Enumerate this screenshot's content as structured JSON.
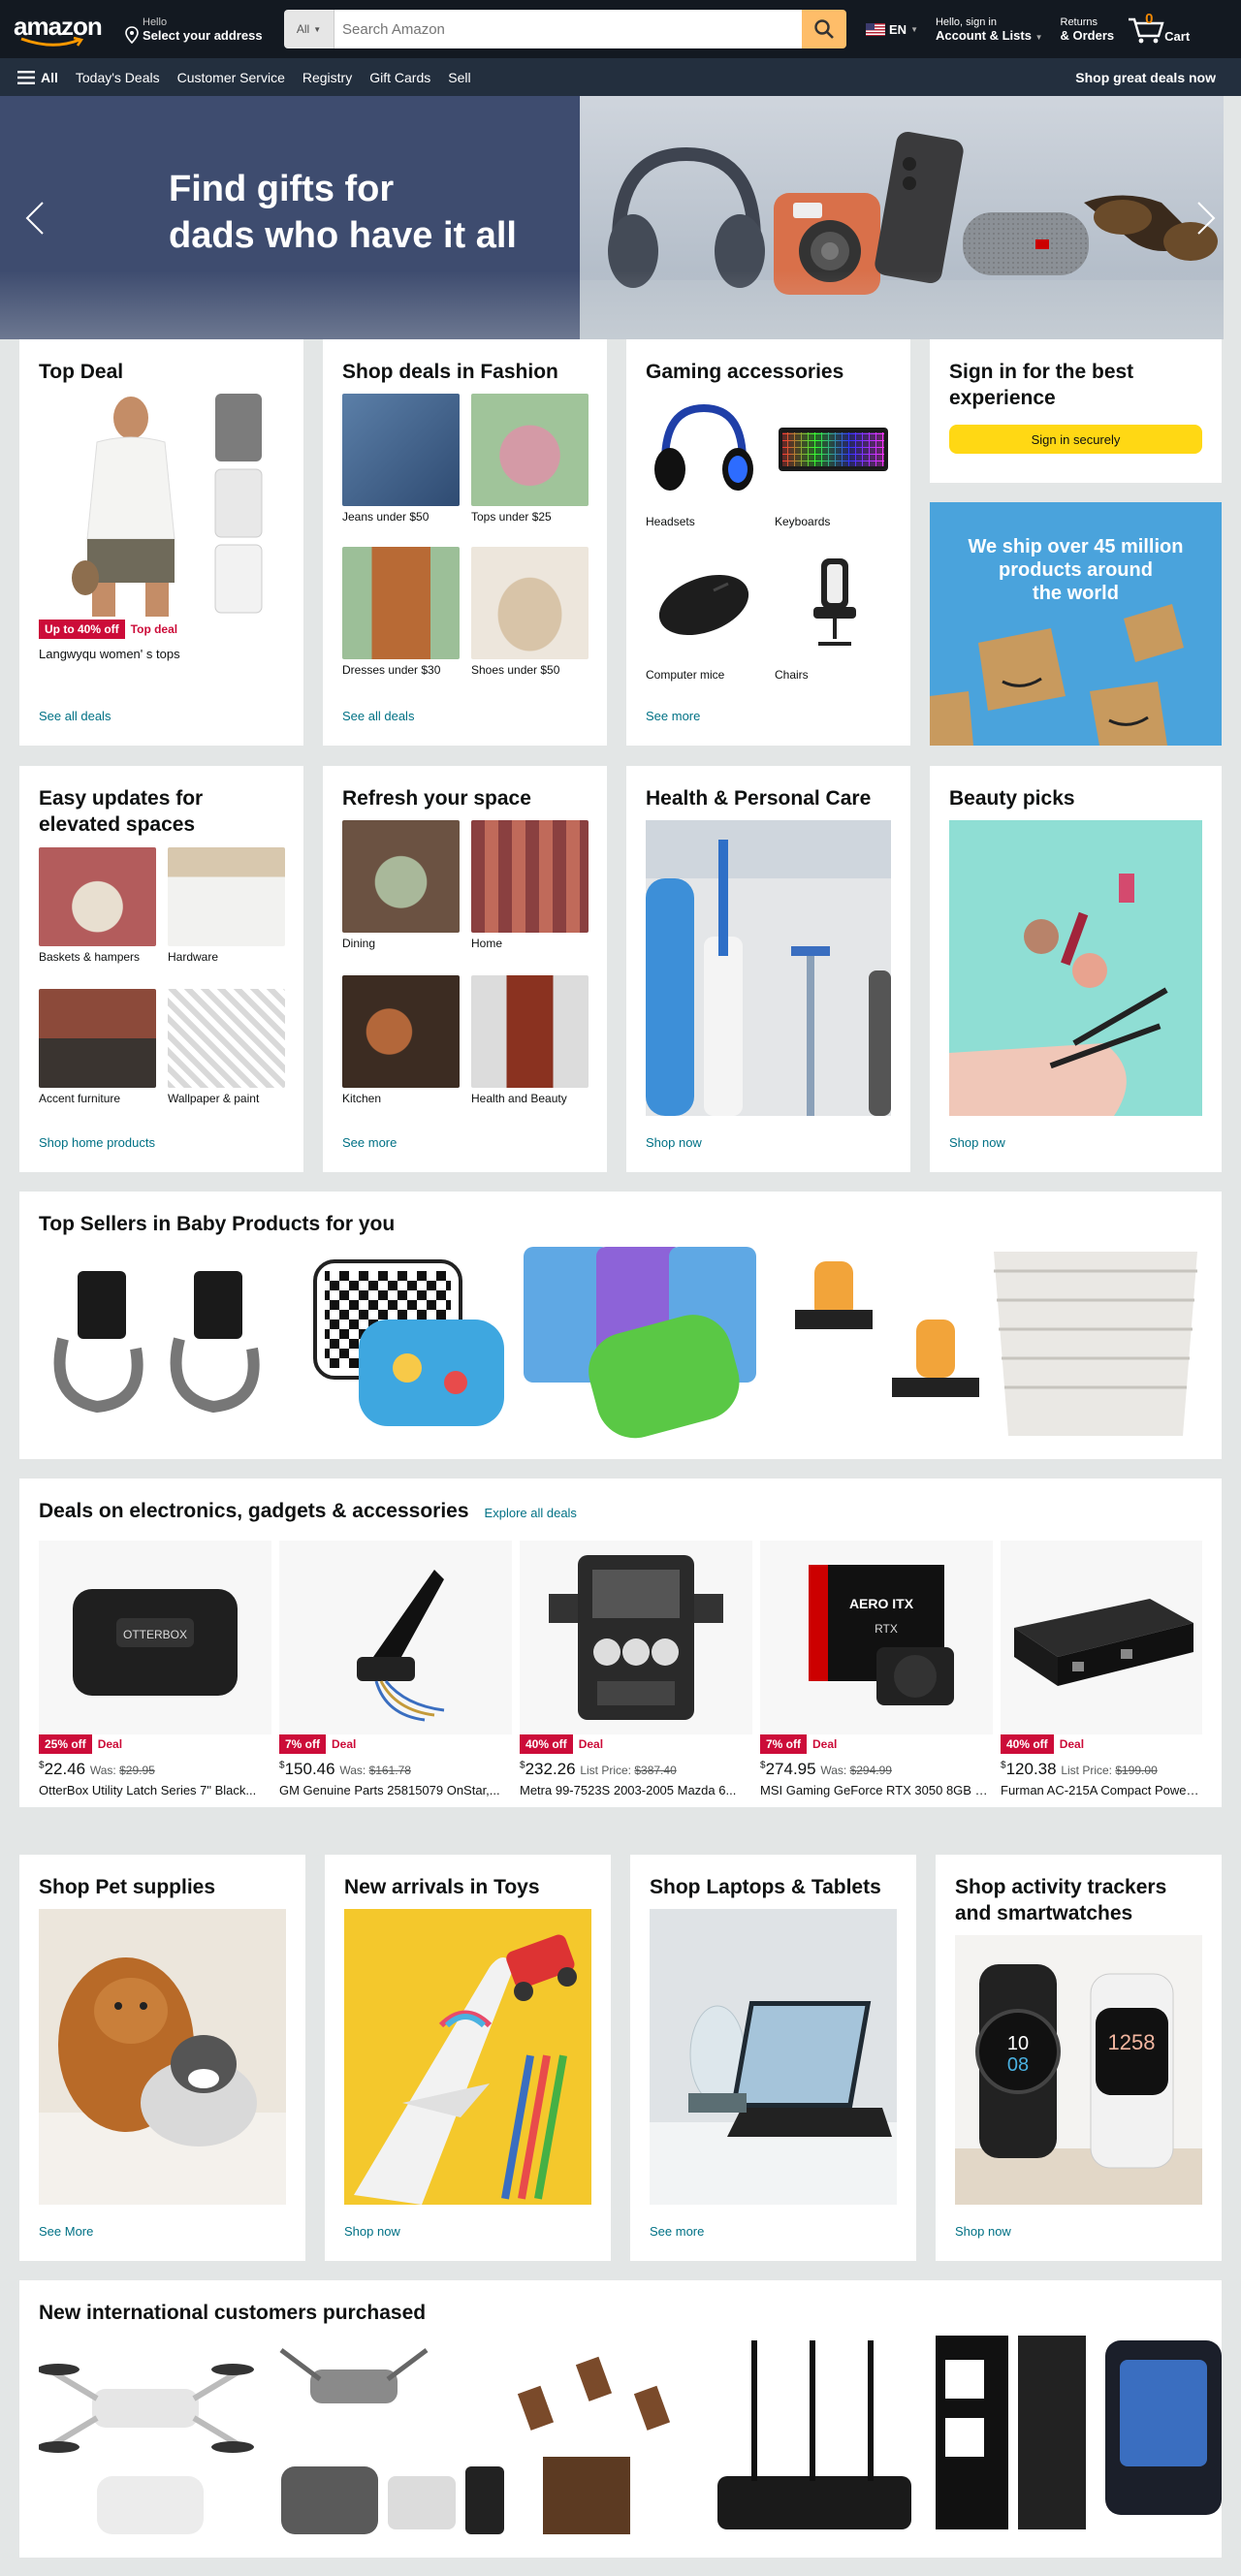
{
  "header": {
    "logo_text": "amazon",
    "address_line1": "Hello",
    "address_line2": "Select your address",
    "search_category": "All",
    "search_placeholder": "Search Amazon",
    "language": "EN",
    "account_line1": "Hello, sign in",
    "account_line2": "Account & Lists",
    "returns_line1": "Returns",
    "returns_line2": "& Orders",
    "cart_count": "0",
    "cart_label": "Cart"
  },
  "subnav": {
    "all_label": "All",
    "items": [
      "Today's Deals",
      "Customer Service",
      "Registry",
      "Gift Cards",
      "Sell"
    ],
    "right_label": "Shop great deals now"
  },
  "hero": {
    "title_line1": "Find gifts for",
    "title_line2": "dads who have it all"
  },
  "row1": {
    "top_deal": {
      "title": "Top Deal",
      "badge": "Up to 40% off",
      "deal_label": "Top deal",
      "product": "Langwyqu women' s tops",
      "link": "See all deals"
    },
    "fashion": {
      "title": "Shop deals in Fashion",
      "items": [
        "Jeans under $50",
        "Tops under $25",
        "Dresses under $30",
        "Shoes under $50"
      ],
      "link": "See all deals"
    },
    "gaming": {
      "title": "Gaming accessories",
      "items": [
        "Headsets",
        "Keyboards",
        "Computer mice",
        "Chairs"
      ],
      "link": "See more"
    },
    "signin": {
      "title": "Sign in for the best experience",
      "button": "Sign in securely"
    },
    "ship_banner": {
      "text_line1": "We ship over 45 million",
      "text_line2": "products around",
      "text_line3": "the world"
    }
  },
  "row2": {
    "easy": {
      "title": "Easy updates for elevated spaces",
      "items": [
        "Baskets & hampers",
        "Hardware",
        "Accent furniture",
        "Wallpaper & paint"
      ],
      "link": "Shop home products"
    },
    "refresh": {
      "title": "Refresh your space",
      "items": [
        "Dining",
        "Home",
        "Kitchen",
        "Health and Beauty"
      ],
      "link": "See more"
    },
    "health": {
      "title": "Health & Personal Care",
      "link": "Shop now"
    },
    "beauty": {
      "title": "Beauty picks",
      "link": "Shop now"
    }
  },
  "baby": {
    "title": "Top Sellers in Baby Products for you"
  },
  "electronics": {
    "title": "Deals on electronics, gadgets & accessories",
    "explore": "Explore all deals",
    "products": [
      {
        "badge": "25% off",
        "deal": "Deal",
        "dollars": "22",
        "cents": "46",
        "was_label": "Was:",
        "was": "$29.95",
        "title": "OtterBox Utility Latch Series 7\" Black..."
      },
      {
        "badge": "7% off",
        "deal": "Deal",
        "dollars": "150",
        "cents": "46",
        "was_label": "Was:",
        "was": "$161.78",
        "title": "GM Genuine Parts 25815079 OnStar,..."
      },
      {
        "badge": "40% off",
        "deal": "Deal",
        "dollars": "232",
        "cents": "26",
        "was_label": "List Price:",
        "was": "$387.40",
        "title": "Metra 99-7523S 2003-2005 Mazda 6..."
      },
      {
        "badge": "7% off",
        "deal": "Deal",
        "dollars": "274",
        "cents": "95",
        "was_label": "Was:",
        "was": "$294.99",
        "title": "MSI Gaming GeForce RTX 3050 8GB G..."
      },
      {
        "badge": "40% off",
        "deal": "Deal",
        "dollars": "120",
        "cents": "38",
        "was_label": "List Price:",
        "was": "$199.00",
        "title": "Furman AC-215A Compact Power C..."
      }
    ],
    "graphic_labels": [
      "OTTERBOX",
      "AERO ITX",
      "RTX"
    ]
  },
  "row4": {
    "pet": {
      "title": "Shop Pet supplies",
      "link": "See More"
    },
    "toys": {
      "title": "New arrivals in Toys",
      "link": "Shop now"
    },
    "laptops": {
      "title": "Shop Laptops & Tablets",
      "link": "See more"
    },
    "trackers": {
      "title": "Shop activity trackers and smartwatches",
      "link": "Shop now",
      "watch1_time": "10",
      "watch1_time2": "08",
      "watch2_time": "12",
      "watch2_time2": "58"
    }
  },
  "intl": {
    "title": "New international customers purchased"
  },
  "colors": {
    "nav_bg": "#131921",
    "subnav_bg": "#232f3e",
    "search_button": "#febd69",
    "deal_red": "#cc0c39",
    "link_teal": "#007185",
    "signin_yellow": "#ffd814",
    "ship_blue": "#4aa3dc"
  },
  "icons": [
    "location-pin-icon",
    "search-icon",
    "cart-icon",
    "hamburger-menu-icon",
    "chevron-left-icon",
    "chevron-right-icon"
  ]
}
